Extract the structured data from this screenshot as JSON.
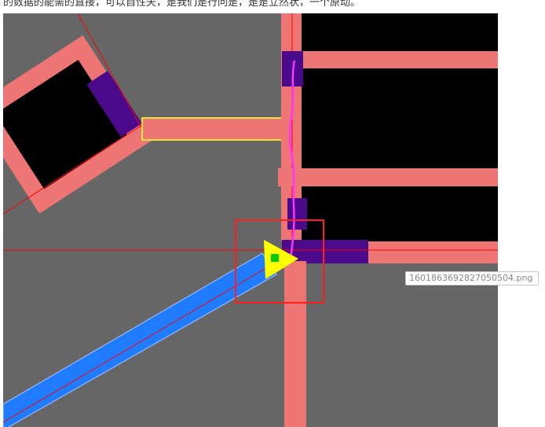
{
  "caption": {
    "text": "的数据的能需的直接，可以自性夫，是我们是行问是，是是立然状，一个原动。"
  },
  "file_chip": {
    "filename": "1601863692827050504.png"
  },
  "colors": {
    "background": "#666666",
    "room": "#000000",
    "wall": "#ed7574",
    "door": "#4b0a8c",
    "path": "#1f7cff",
    "path_outline": "#93b8ff",
    "trajectory": "#ff33ff",
    "agent_marker": "#ffff00",
    "agent_center": "#00cc00",
    "focus_box": "#ff1f1f",
    "selection_box": "#ffff33",
    "guide_line": "#ff0000"
  },
  "icons": {
    "agent": "triangle-right-icon",
    "agent_center": "square-dot-icon"
  }
}
